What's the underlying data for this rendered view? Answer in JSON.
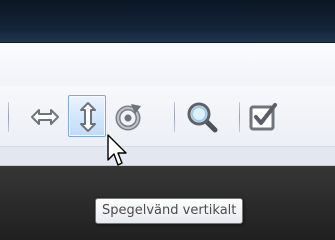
{
  "toolbar": {
    "tools": [
      {
        "name": "flip-horizontal",
        "icon": "horizontal-arrows-icon"
      },
      {
        "name": "flip-vertical",
        "icon": "vertical-arrows-icon",
        "state": "hovered"
      },
      {
        "name": "rotate",
        "icon": "rotate-icon"
      },
      {
        "name": "zoom",
        "icon": "magnifier-icon"
      },
      {
        "name": "checkbox",
        "icon": "checkmark-box-icon"
      }
    ]
  },
  "tooltip": {
    "text": "Spegelvänd vertikalt"
  },
  "colors": {
    "titlebar": "#14253a",
    "toolbar_bg": "#f1f3f7",
    "hover_border": "#7ca9e2",
    "hover_fill": "#cfe5fc",
    "statusbar": "#2a2a2a"
  }
}
